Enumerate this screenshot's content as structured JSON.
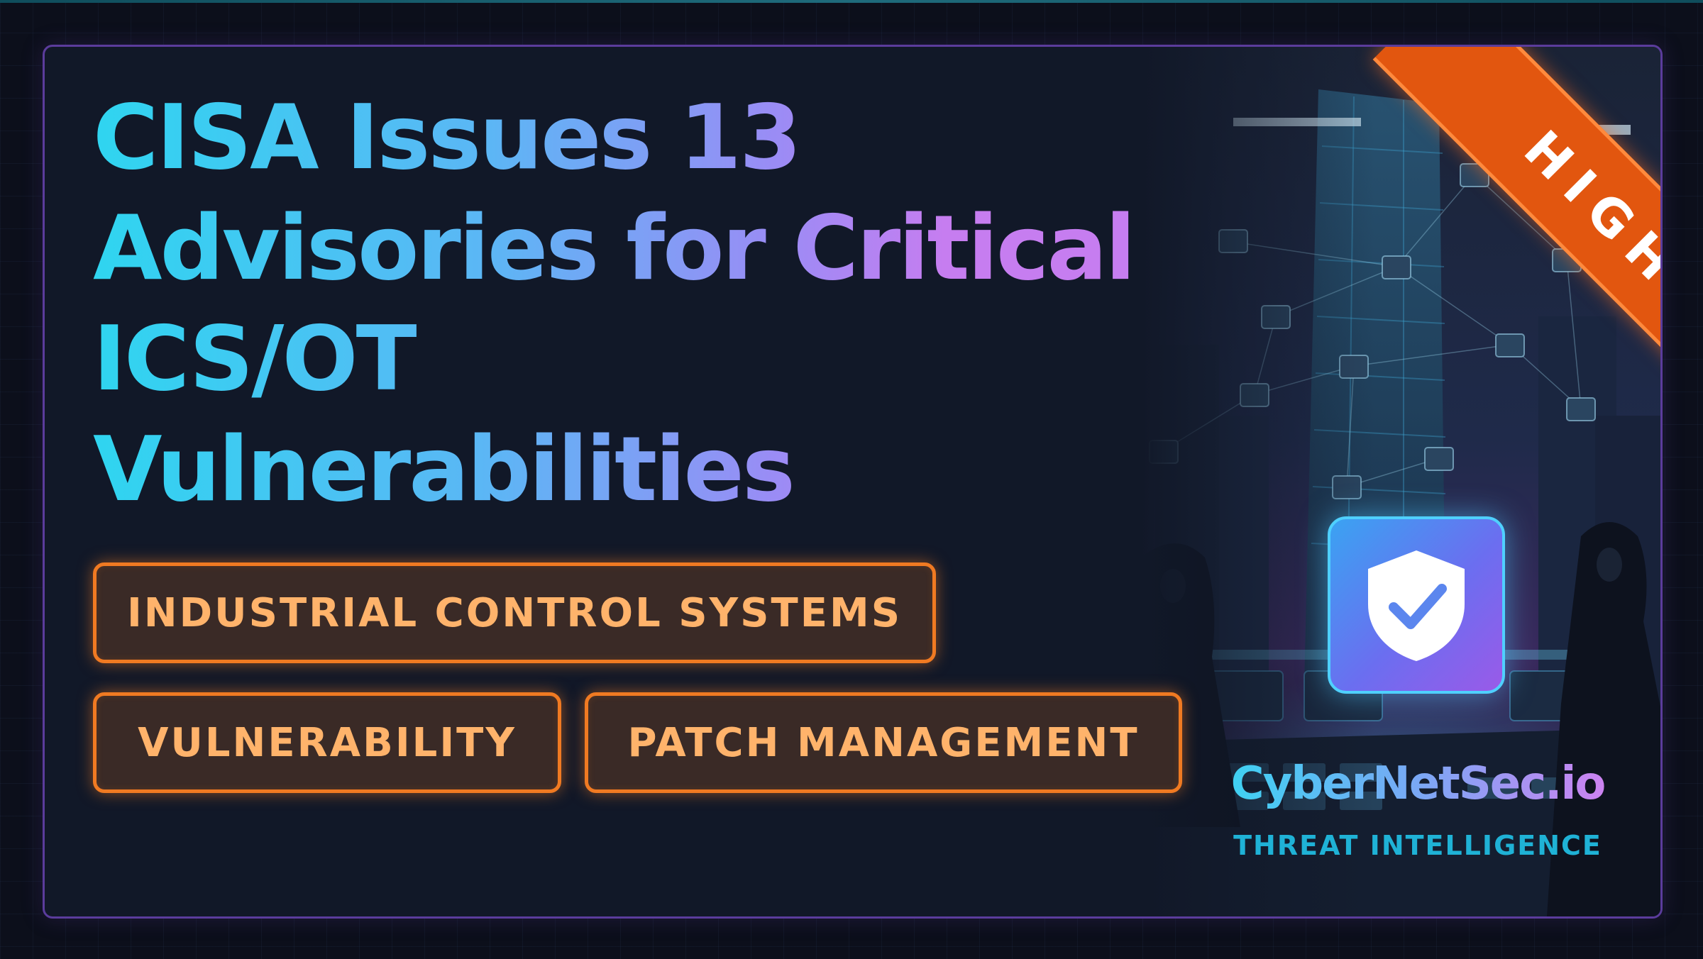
{
  "title": {
    "line1": "CISA Issues 13",
    "line2": "Advisories for Critical",
    "line3": "ICS/OT",
    "line4": "Vulnerabilities"
  },
  "tags": [
    {
      "label": "INDUSTRIAL CONTROL SYSTEMS"
    },
    {
      "label": "VULNERABILITY"
    },
    {
      "label": "PATCH MANAGEMENT"
    }
  ],
  "severity": {
    "label": "HIGH"
  },
  "brand": {
    "name": "CyberNetSec.io",
    "tagline": "THREAT INTELLIGENCE"
  },
  "icons": [
    "shield-check-icon"
  ],
  "colors": {
    "title_gradient": [
      "#2fd5f0",
      "#9a8cf5",
      "#c67df0"
    ],
    "tag_border": "#f07a22",
    "tag_text": "#ffb36b",
    "ribbon": "#e2560f",
    "card_border": "#5b3c9c",
    "background": "#111828"
  }
}
